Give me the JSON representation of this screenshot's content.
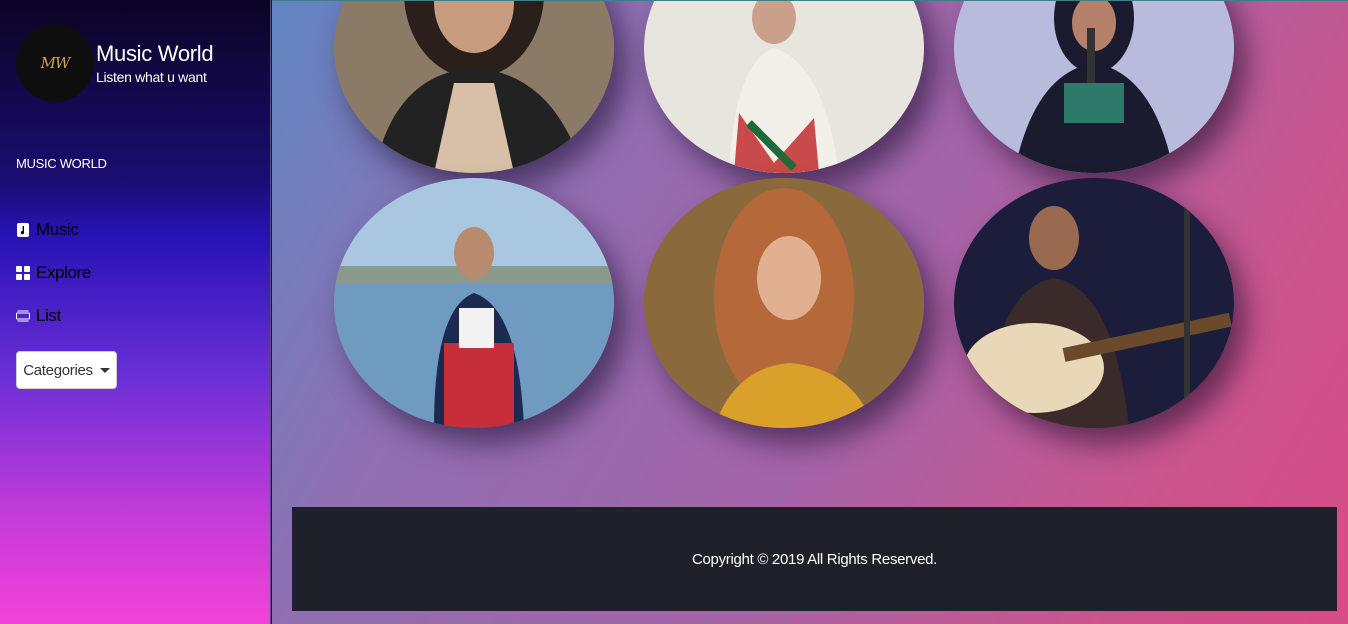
{
  "brand": {
    "logo_text": "MW",
    "title": "Music World",
    "subtitle": "Listen what u want"
  },
  "sidebar": {
    "section_label": "MUSIC WORLD",
    "items": [
      {
        "label": "Music",
        "icon": "music-note-icon"
      },
      {
        "label": "Explore",
        "icon": "grid-icon"
      },
      {
        "label": "List",
        "icon": "list-icon"
      }
    ],
    "dropdown_label": "Categories"
  },
  "artists": [
    {
      "name": "artist-1",
      "palette": [
        "#8a7a66",
        "#2a1f1a",
        "#d8c0a8"
      ]
    },
    {
      "name": "artist-2",
      "palette": [
        "#e8e4de",
        "#c94a4a",
        "#f2eee8"
      ]
    },
    {
      "name": "artist-3",
      "palette": [
        "#d9c2e6",
        "#1a1b2e",
        "#7ab0c9"
      ]
    },
    {
      "name": "artist-4",
      "palette": [
        "#a9c7e0",
        "#c62f3a",
        "#1c2a52"
      ]
    },
    {
      "name": "artist-5",
      "palette": [
        "#8a6a3c",
        "#d9a02a",
        "#b5683a"
      ]
    },
    {
      "name": "artist-6",
      "palette": [
        "#1c1d3a",
        "#e8d8b8",
        "#3a2a2a"
      ]
    }
  ],
  "footer": {
    "copyright": "Copyright © 2019 All Rights Reserved."
  },
  "colors": {
    "footer_bg": "#1e2129",
    "logo_gold": "#c9a44a"
  }
}
